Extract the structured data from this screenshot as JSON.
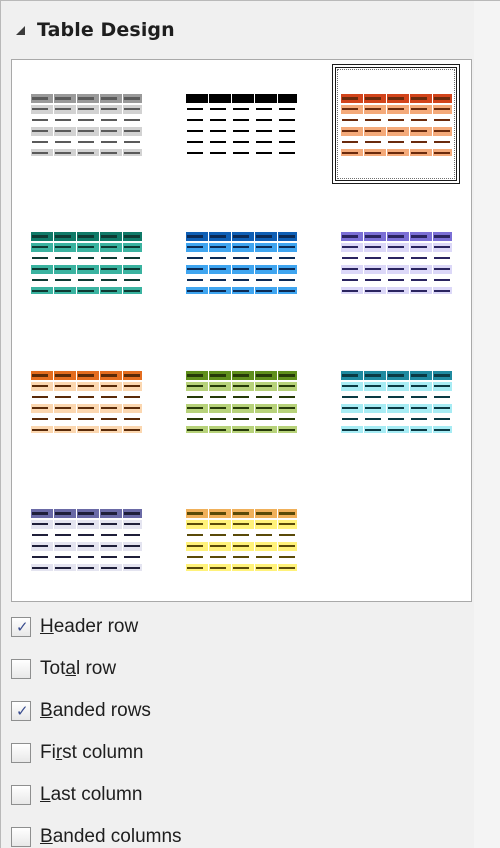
{
  "section": {
    "title": "Table Design",
    "expanded": true
  },
  "gallery": {
    "styles": [
      {
        "name": "gray",
        "header": "#9a9a9a",
        "band": "#d2d2d2",
        "line": "#5a5a5a",
        "selected": false
      },
      {
        "name": "black",
        "header": "#000000",
        "band": "#ffffff",
        "line": "#000000",
        "selected": false
      },
      {
        "name": "orange",
        "header": "#d2441b",
        "band": "#f4aa7a",
        "line": "#6a2a0c",
        "selected": true
      },
      {
        "name": "teal",
        "header": "#0f7a68",
        "band": "#3ab3a0",
        "line": "#0d3a33",
        "selected": false
      },
      {
        "name": "blue",
        "header": "#0f5fb5",
        "band": "#3fa5f0",
        "line": "#0b2a55",
        "selected": false
      },
      {
        "name": "lavender",
        "header": "#7b6fd6",
        "band": "#dcd8f8",
        "line": "#2a2460",
        "selected": false
      },
      {
        "name": "orange-light",
        "header": "#e46d1f",
        "band": "#fbd7b0",
        "line": "#5a2a08",
        "selected": false
      },
      {
        "name": "olive",
        "header": "#5f8f1c",
        "band": "#b7d27a",
        "line": "#263a08",
        "selected": false
      },
      {
        "name": "cyan",
        "header": "#1f8aa0",
        "band": "#a7ecf4",
        "line": "#0a3a44",
        "selected": false
      },
      {
        "name": "slate",
        "header": "#6a6aa6",
        "band": "#e4e4f0",
        "line": "#1f1f3a",
        "selected": false
      },
      {
        "name": "yellow",
        "header": "#f0b05a",
        "band": "#fff27a",
        "line": "#5a4a08",
        "selected": false
      }
    ]
  },
  "options": [
    {
      "id": "header-row",
      "label": "Header row",
      "accesskey_index": 0,
      "checked": true
    },
    {
      "id": "total-row",
      "label": "Total row",
      "accesskey_index": 3,
      "checked": false
    },
    {
      "id": "banded-rows",
      "label": "Banded rows",
      "accesskey_index": 0,
      "checked": true
    },
    {
      "id": "first-column",
      "label": "First column",
      "accesskey_index": 2,
      "checked": false
    },
    {
      "id": "last-column",
      "label": "Last column",
      "accesskey_index": 0,
      "checked": false
    },
    {
      "id": "banded-columns",
      "label": "Banded columns",
      "accesskey_index": 0,
      "checked": false
    }
  ],
  "colors": {
    "panel_bg": "#f0f0f0",
    "check": "#3a4d8f"
  }
}
